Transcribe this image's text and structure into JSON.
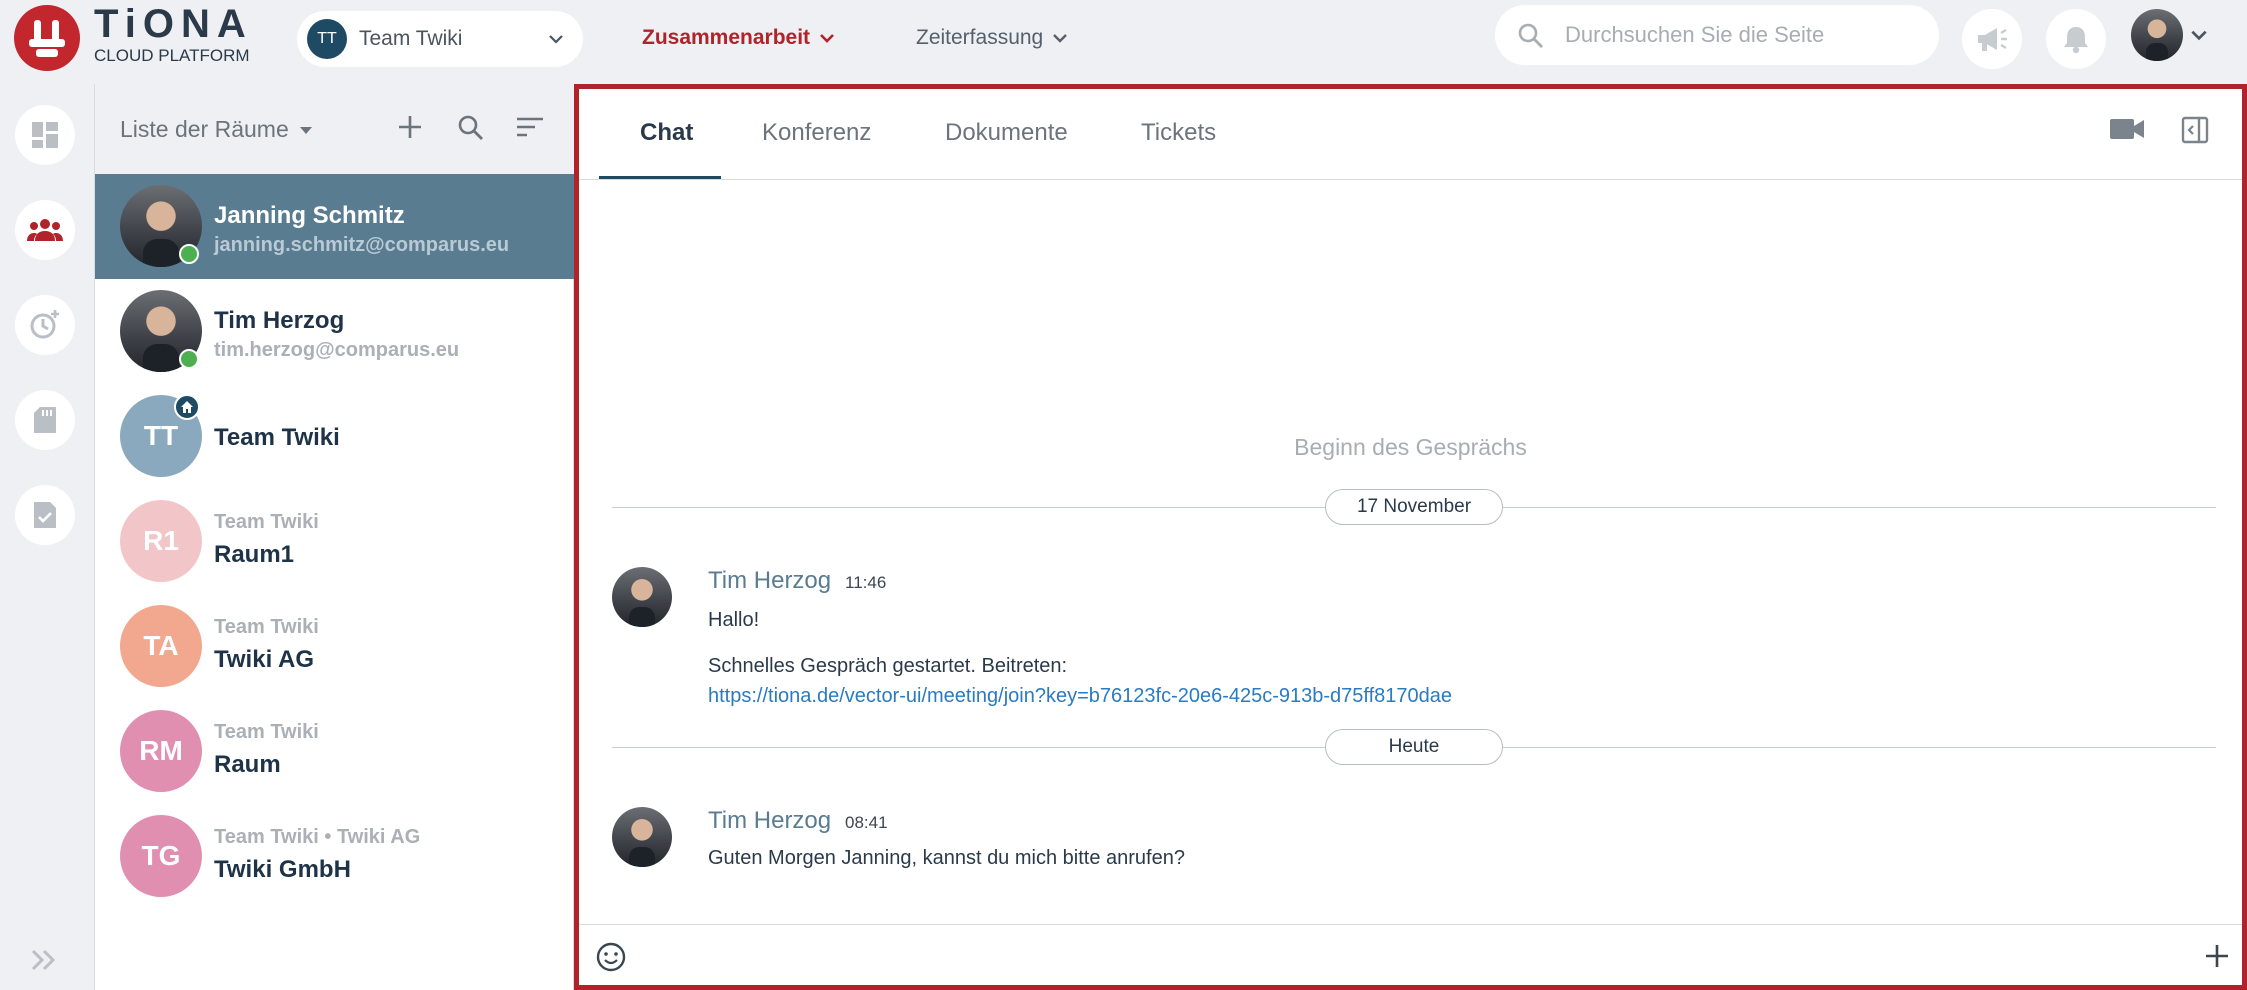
{
  "brand": {
    "title": "TiONA",
    "subtitle": "CLOUD PLATFORM",
    "accent": "#c1272d"
  },
  "team": {
    "initials": "TT",
    "name": "Team Twiki"
  },
  "nav": {
    "collaboration": "Zusammenarbeit",
    "time_tracking": "Zeiterfassung"
  },
  "search": {
    "placeholder": "Durchsuchen Sie die Seite"
  },
  "rail": {
    "icons": [
      "dashboard-icon",
      "people-icon",
      "timer-icon",
      "document-icon",
      "task-icon",
      "expand-icon"
    ]
  },
  "rooms": {
    "title": "Liste der Räume",
    "items": [
      {
        "name": "Janning Schmitz",
        "sub": "janning.schmitz@comparus.eu",
        "active": true,
        "online": true,
        "photo": true
      },
      {
        "name": "Tim Herzog",
        "sub": "tim.herzog@comparus.eu",
        "active": false,
        "online": true,
        "photo": true
      },
      {
        "name": "Team Twiki",
        "sub": "",
        "initials": "TT",
        "color": "#8aa9be",
        "home": true
      },
      {
        "name": "Raum1",
        "sub": "Team Twiki",
        "initials": "R1",
        "color": "#f2c6c8"
      },
      {
        "name": "Twiki AG",
        "sub": "Team Twiki",
        "initials": "TA",
        "color": "#f2a88f"
      },
      {
        "name": "Raum",
        "sub": "Team Twiki",
        "initials": "RM",
        "color": "#e18fb1"
      },
      {
        "name": "Twiki GmbH",
        "sub": "Team Twiki • Twiki AG",
        "initials": "TG",
        "color": "#e18fb1"
      }
    ]
  },
  "tabs": [
    {
      "label": "Chat",
      "active": true
    },
    {
      "label": "Konferenz"
    },
    {
      "label": "Dokumente"
    },
    {
      "label": "Tickets"
    }
  ],
  "chat": {
    "begin": "Beginn des Gesprächs",
    "date1": "17 November",
    "date2": "Heute",
    "messages": [
      {
        "sender": "Tim Herzog",
        "time": "11:46",
        "lines": [
          "Hallo!",
          "Schnelles Gespräch gestartet. Beitreten:"
        ],
        "link": "https://tiona.de/vector-ui/meeting/join?key=b76123fc-20e6-425c-913b-d75ff8170dae"
      },
      {
        "sender": "Tim Herzog",
        "time": "08:41",
        "lines": [
          "Guten Morgen Janning, kannst du mich bitte anrufen?"
        ]
      }
    ]
  },
  "composer": {
    "value": ""
  }
}
